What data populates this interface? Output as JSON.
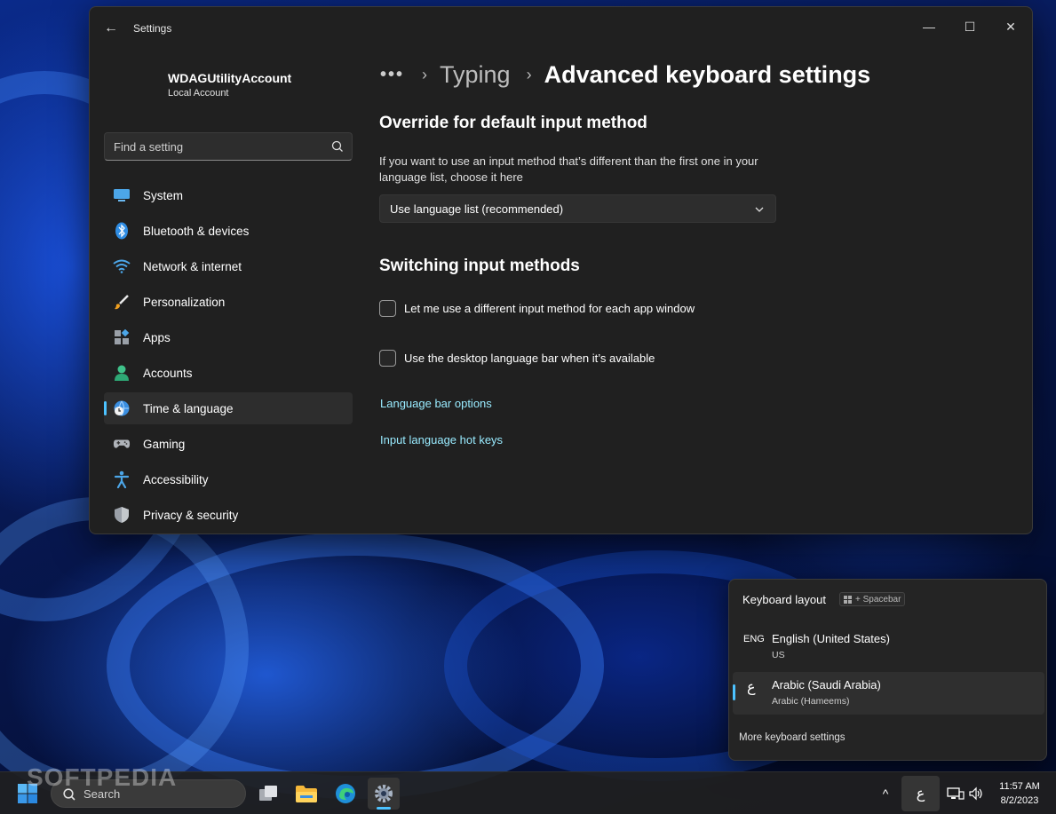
{
  "window": {
    "app_title": "Settings",
    "back_label": "←",
    "minimize_label": "—",
    "maximize_label": "☐",
    "close_label": "✕"
  },
  "account": {
    "name": "WDAGUtilityAccount",
    "type": "Local Account"
  },
  "search": {
    "placeholder": "Find a setting"
  },
  "sidebar": {
    "items": [
      {
        "label": "System",
        "icon": "system-icon"
      },
      {
        "label": "Bluetooth & devices",
        "icon": "bluetooth-icon"
      },
      {
        "label": "Network & internet",
        "icon": "wifi-icon"
      },
      {
        "label": "Personalization",
        "icon": "brush-icon"
      },
      {
        "label": "Apps",
        "icon": "apps-icon"
      },
      {
        "label": "Accounts",
        "icon": "person-icon"
      },
      {
        "label": "Time & language",
        "icon": "globe-clock-icon",
        "active": true
      },
      {
        "label": "Gaming",
        "icon": "gamepad-icon"
      },
      {
        "label": "Accessibility",
        "icon": "accessibility-icon"
      },
      {
        "label": "Privacy & security",
        "icon": "shield-icon"
      }
    ]
  },
  "breadcrumb": {
    "more": "•••",
    "sep": "›",
    "parent": "Typing",
    "current": "Advanced keyboard settings"
  },
  "main": {
    "override_title": "Override for default input method",
    "override_desc": "If you want to use an input method that’s different than the first one in your language list, choose it here",
    "dropdown_value": "Use language list (recommended)",
    "switching_title": "Switching input methods",
    "checkbox1_label": "Let me use a different input method for each app window",
    "checkbox2_label": "Use the desktop language bar when it’s available",
    "link1": "Language bar options",
    "link2": "Input language hot keys"
  },
  "keyboard_flyout": {
    "title": "Keyboard layout",
    "shortcut": "+ Spacebar",
    "layouts": [
      {
        "code": "ENG",
        "name": "English (United States)",
        "sub": "US"
      },
      {
        "code": "ع",
        "name": "Arabic (Saudi Arabia)",
        "sub": "Arabic (Hameems)",
        "active": true
      }
    ],
    "more": "More keyboard settings"
  },
  "taskbar": {
    "search_label": "Search",
    "tray_chevron": "^",
    "input_indicator": "ع",
    "time": "11:57 AM",
    "date": "8/2/2023"
  },
  "watermark": "SOFTPEDIA",
  "colors": {
    "accent": "#4cc2ff",
    "link": "#99ebff",
    "window_bg": "#202020"
  }
}
